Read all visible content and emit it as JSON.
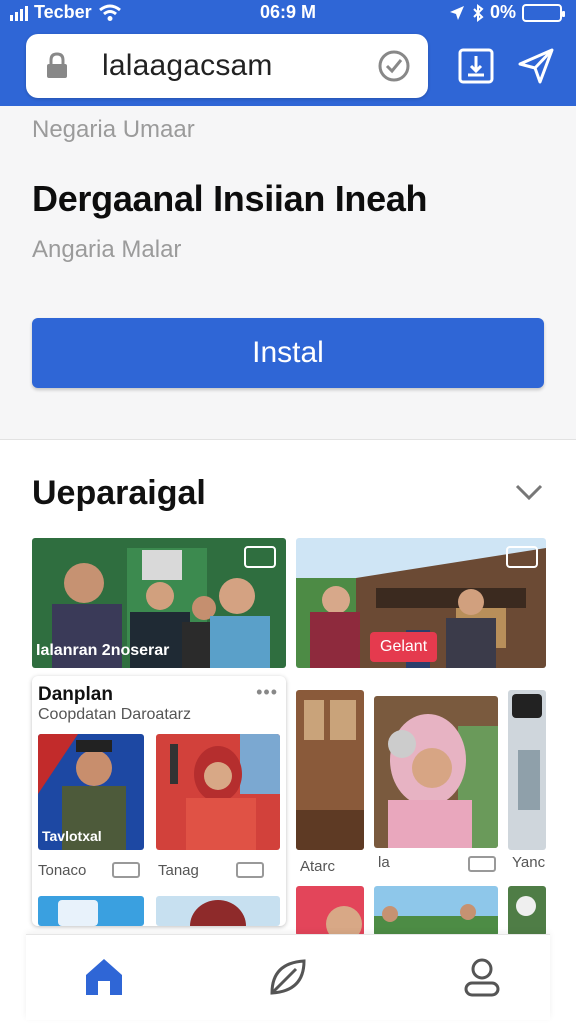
{
  "status_bar": {
    "carrier": "Tecber",
    "time": "06:9 M",
    "battery": "0%"
  },
  "browser": {
    "url": "lalaagacsam",
    "icons": [
      "lock-icon",
      "shield-check-icon",
      "download-icon",
      "send-icon"
    ]
  },
  "app": {
    "developer": "Negaria Umaar",
    "title": "Dergaanal Insiian Ineah",
    "subtitle": "Angaria Malar",
    "install_label": "Instal"
  },
  "section": {
    "title": "Ueparaigal",
    "tiles": [
      {
        "label": "Ialanran 2noserar"
      },
      {
        "label": "Gelant"
      }
    ],
    "card": {
      "title": "Danplan",
      "subtitle": "Coopdatan Daroatarz",
      "items": [
        {
          "caption": "Tonaco",
          "overlay": "Tavlotxal"
        },
        {
          "caption": "Tanag"
        }
      ]
    },
    "captions": [
      "Atarc",
      "la",
      "Yanc"
    ]
  },
  "colors": {
    "brand_blue": "#2f66d6",
    "accent_red": "#e53a4e"
  },
  "bottom_nav": {
    "items": [
      "home-icon",
      "leaf-icon",
      "profile-icon"
    ]
  }
}
